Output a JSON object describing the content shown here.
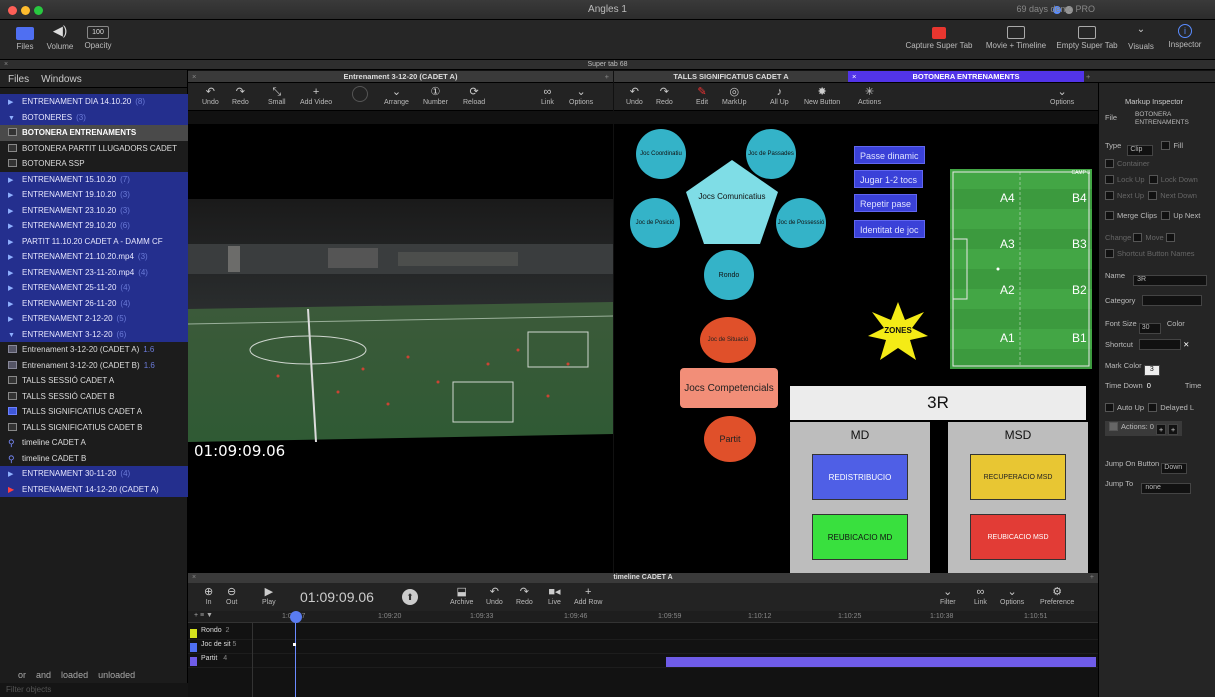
{
  "window": {
    "title": "Angles 1",
    "trial": "69 days demo PRO"
  },
  "toolbar": {
    "left": [
      {
        "label": "Files",
        "icon": "folder-icon"
      },
      {
        "label": "Volume",
        "icon": "speaker-icon"
      },
      {
        "label": "Opacity",
        "value": "100"
      }
    ],
    "right": [
      {
        "label": "Capture Super Tab",
        "icon": "camera-icon"
      },
      {
        "label": "Movie + Timeline",
        "icon": "layout-icon"
      },
      {
        "label": "Empty Super Tab",
        "icon": "grid-icon"
      },
      {
        "label": "Visuals",
        "icon": "chevron-down-icon"
      },
      {
        "label": "Inspector",
        "icon": "info-icon"
      }
    ]
  },
  "supertab": {
    "title": "Super tab 68"
  },
  "sidebar": {
    "tabs": [
      "Files",
      "Windows"
    ],
    "items": [
      {
        "label": "ENTRENAMENT DIA 14.10.20",
        "count": "(8)",
        "kind": "folder",
        "style": "blue"
      },
      {
        "label": "BOTONERES",
        "count": "(3)",
        "kind": "folder-open",
        "style": "blue"
      },
      {
        "label": "BOTONERA ENTRENAMENTS",
        "count": "",
        "kind": "doc",
        "style": "sel"
      },
      {
        "label": "BOTONERA PARTIT LLUGADORS CADET",
        "count": "",
        "kind": "doc",
        "style": "dark"
      },
      {
        "label": "BOTONERA SSP",
        "count": "",
        "kind": "doc",
        "style": "dark"
      },
      {
        "label": "ENTRENAMENT 15.10.20",
        "count": "(7)",
        "kind": "folder",
        "style": "blue"
      },
      {
        "label": "ENTRENAMENT 19.10.20",
        "count": "(3)",
        "kind": "folder",
        "style": "blue"
      },
      {
        "label": "ENTRENAMENT 23.10.20",
        "count": "(3)",
        "kind": "folder",
        "style": "blue"
      },
      {
        "label": "ENTRENAMENT 29.10.20",
        "count": "(6)",
        "kind": "folder",
        "style": "blue"
      },
      {
        "label": "PARTIT 11.10.20 CADET A - DAMM CF",
        "count": "",
        "kind": "folder",
        "style": "blue"
      },
      {
        "label": "ENTRENAMENT 21.10.20.mp4",
        "count": "(3)",
        "kind": "folder",
        "style": "blue"
      },
      {
        "label": "ENTRENAMENT 23-11-20.mp4",
        "count": "(4)",
        "kind": "folder",
        "style": "blue"
      },
      {
        "label": "ENTRENAMENT 25-11-20",
        "count": "(4)",
        "kind": "folder",
        "style": "blue"
      },
      {
        "label": "ENTRENAMENT 26-11-20",
        "count": "(4)",
        "kind": "folder",
        "style": "blue"
      },
      {
        "label": "ENTRENAMENT 2-12-20",
        "count": "(5)",
        "kind": "folder",
        "style": "blue"
      },
      {
        "label": "ENTRENAMENT 3-12-20",
        "count": "(6)",
        "kind": "folder-open",
        "style": "blue"
      },
      {
        "label": "Entrenament 3-12-20 (CADET A)",
        "count": "1.6",
        "kind": "film",
        "style": "dark"
      },
      {
        "label": "Entrenament 3-12-20 (CADET B)",
        "count": "1.6",
        "kind": "film",
        "style": "dark"
      },
      {
        "label": "TALLS SESSIÓ CADET A",
        "count": "",
        "kind": "doc",
        "style": "dark"
      },
      {
        "label": "TALLS SESSIÓ CADET B",
        "count": "",
        "kind": "doc",
        "style": "dark"
      },
      {
        "label": "TALLS SIGNIFICATIUS CADET A",
        "count": "",
        "kind": "blu",
        "style": "dark"
      },
      {
        "label": "TALLS SIGNIFICATIUS CADET B",
        "count": "",
        "kind": "doc",
        "style": "dark"
      },
      {
        "label": "timeline CADET A",
        "count": "",
        "kind": "tl",
        "style": "dark"
      },
      {
        "label": "timeline CADET B",
        "count": "",
        "kind": "tl",
        "style": "dark"
      },
      {
        "label": "ENTRENAMENT 30-11-20",
        "count": "(4)",
        "kind": "folder",
        "style": "blue"
      },
      {
        "label": "ENTRENAMENT 14-12-20 (CADET A)",
        "count": "",
        "kind": "play",
        "style": "blue"
      }
    ],
    "filters": [
      "or",
      "and",
      "loaded",
      "unloaded"
    ],
    "search_placeholder": "Filter objects"
  },
  "video_panel": {
    "title": "Entrenament 3-12-20 (CADET A)",
    "tools": [
      "Undo",
      "Redo",
      "Small",
      "Add Video",
      "",
      "Arrange",
      "Number",
      "Reload",
      "Link",
      "Options"
    ],
    "timecode": "01:09:09.06"
  },
  "tabs_right": [
    {
      "label": "TALLS SIGNIFICATIUS CADET A",
      "active": false
    },
    {
      "label": "BOTONERA ENTRENAMENTS",
      "active": true
    }
  ],
  "buttons_panel": {
    "tools": [
      "Undo",
      "Redo",
      "Edit",
      "MarkUp",
      "All Up",
      "New Button",
      "Actions",
      "Options"
    ],
    "comunicatius": {
      "center": "Jocs Comunicatius",
      "satellites": [
        "Joc Coordinatiu",
        "Joc de Passades",
        "Joc de Posició",
        "Joc de Possessió",
        "Rondo"
      ]
    },
    "passes": [
      "Passe dinamic",
      "Jugar 1-2 tocs",
      "Repetir pase",
      "Identitat de joc"
    ],
    "competencials": {
      "top": "Joc de Situació",
      "center": "Jocs Competencials",
      "bottom": "Partit"
    },
    "zones_label": "ZONES",
    "field": {
      "header": "CAMP 3",
      "zones": [
        "A4",
        "B4",
        "A3",
        "B3",
        "A2",
        "B2",
        "A1",
        "B1"
      ]
    },
    "board": {
      "title": "3R",
      "md": {
        "title": "MD",
        "buttons": [
          "REDISTRIBUCIO",
          "REUBICACIO MD"
        ]
      },
      "msd": {
        "title": "MSD",
        "buttons": [
          "RECUPERACIO MSD",
          "REUBICACIO MSD"
        ]
      }
    }
  },
  "inspector": {
    "title": "Markup Inspector",
    "file_label": "File",
    "file_value": "BOTONERA ENTRENAMENTS",
    "type_label": "Type",
    "type_value": "Clip",
    "fill_label": "Fill",
    "options": [
      "Container",
      "Lock Up",
      "Lock Down",
      "Next Up",
      "Next Down"
    ],
    "merge_clips": "Merge Clips",
    "up_next": "Up Next",
    "change_label": "Change",
    "move_label": "Move",
    "shortcut_below": "Shortcut Button Names",
    "name_label": "Name",
    "name_value": "3R",
    "category_label": "Category",
    "font_size_label": "Font Size",
    "font_size_value": "30",
    "color_label": "Color",
    "shortcut_label": "Shortcut",
    "mark_color_label": "Mark Color",
    "mark_color_value": "3",
    "time_down_label": "Time Down",
    "time_down_value": "0",
    "time_up_label": "Time",
    "auto_up": "Auto Up",
    "delayed": "Delayed L",
    "actions_label": "Actions: 0",
    "jump_on_label": "Jump On Button",
    "jump_on_value": "Down",
    "jump_to_label": "Jump To",
    "jump_to_value": "none"
  },
  "timeline": {
    "title": "timeline CADET A",
    "timecode": "01:09:09.06",
    "tools_left": [
      "In",
      "Out",
      "Play"
    ],
    "tools_mid": [
      "Archive",
      "Undo",
      "Redo",
      "Live",
      "Add Row"
    ],
    "tools_right": [
      "Filter",
      "Link",
      "Options",
      "Preference"
    ],
    "ruler": [
      "1:09:07",
      "1:09:20",
      "1:09:33",
      "1:09:46",
      "1:09:59",
      "1:10:12",
      "1:10:25",
      "1:10:38",
      "1:10:51"
    ],
    "tracks": [
      {
        "name": "Rondo",
        "count": "2",
        "color": "#d6e21d"
      },
      {
        "name": "Joc de sit",
        "count": "5",
        "color": "#4f6ff2"
      },
      {
        "name": "Partit",
        "count": "4",
        "color": "#6f5ce8"
      }
    ]
  },
  "colors": {
    "accent": "#5234e8",
    "folder_blue": "#242f8e",
    "teal": "#34b3c8",
    "orange": "#e0502a"
  }
}
